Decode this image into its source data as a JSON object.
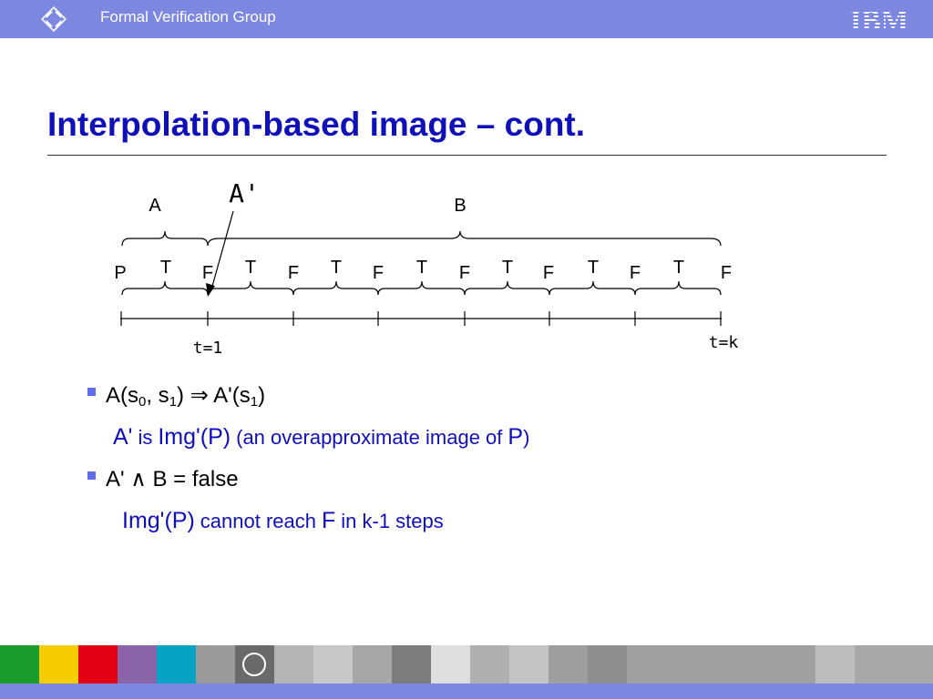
{
  "header": {
    "group_name": "Formal Verification Group",
    "brand": "IBM"
  },
  "slide": {
    "title": "Interpolation-based image – cont."
  },
  "diagram": {
    "labels": {
      "a": "A",
      "b": "B",
      "a_prime": "A'",
      "p": "P",
      "t_markers": [
        "T",
        "T",
        "T",
        "T",
        "T",
        "T",
        "T"
      ],
      "f_markers": [
        "F",
        "F",
        "F",
        "F",
        "F",
        "F",
        "F",
        "F"
      ],
      "t1": "t=1",
      "tk": "t=k"
    }
  },
  "bullets": [
    {
      "main": {
        "p1": "A(s",
        "sub1": "0",
        "p2": ", s",
        "sub2": "1",
        "p3": ") ⇒ A'(s",
        "sub3": "1",
        "p4": ")"
      },
      "sub": {
        "s1": "A'",
        "s2": "is",
        "s3": "Img'(P)",
        "s4": "(an overapproximate image of",
        "s5": "P",
        "s6": ")"
      }
    },
    {
      "main": {
        "text": "A' ∧ B = false"
      },
      "sub": {
        "s1": "Img'(P)",
        "s2": "cannot reach",
        "s3": "F",
        "s4": "in k-1 steps"
      }
    }
  ],
  "colors": {
    "header_bar": "#7c87df",
    "title": "#1010b8",
    "bullet": "#5f6ee8"
  }
}
